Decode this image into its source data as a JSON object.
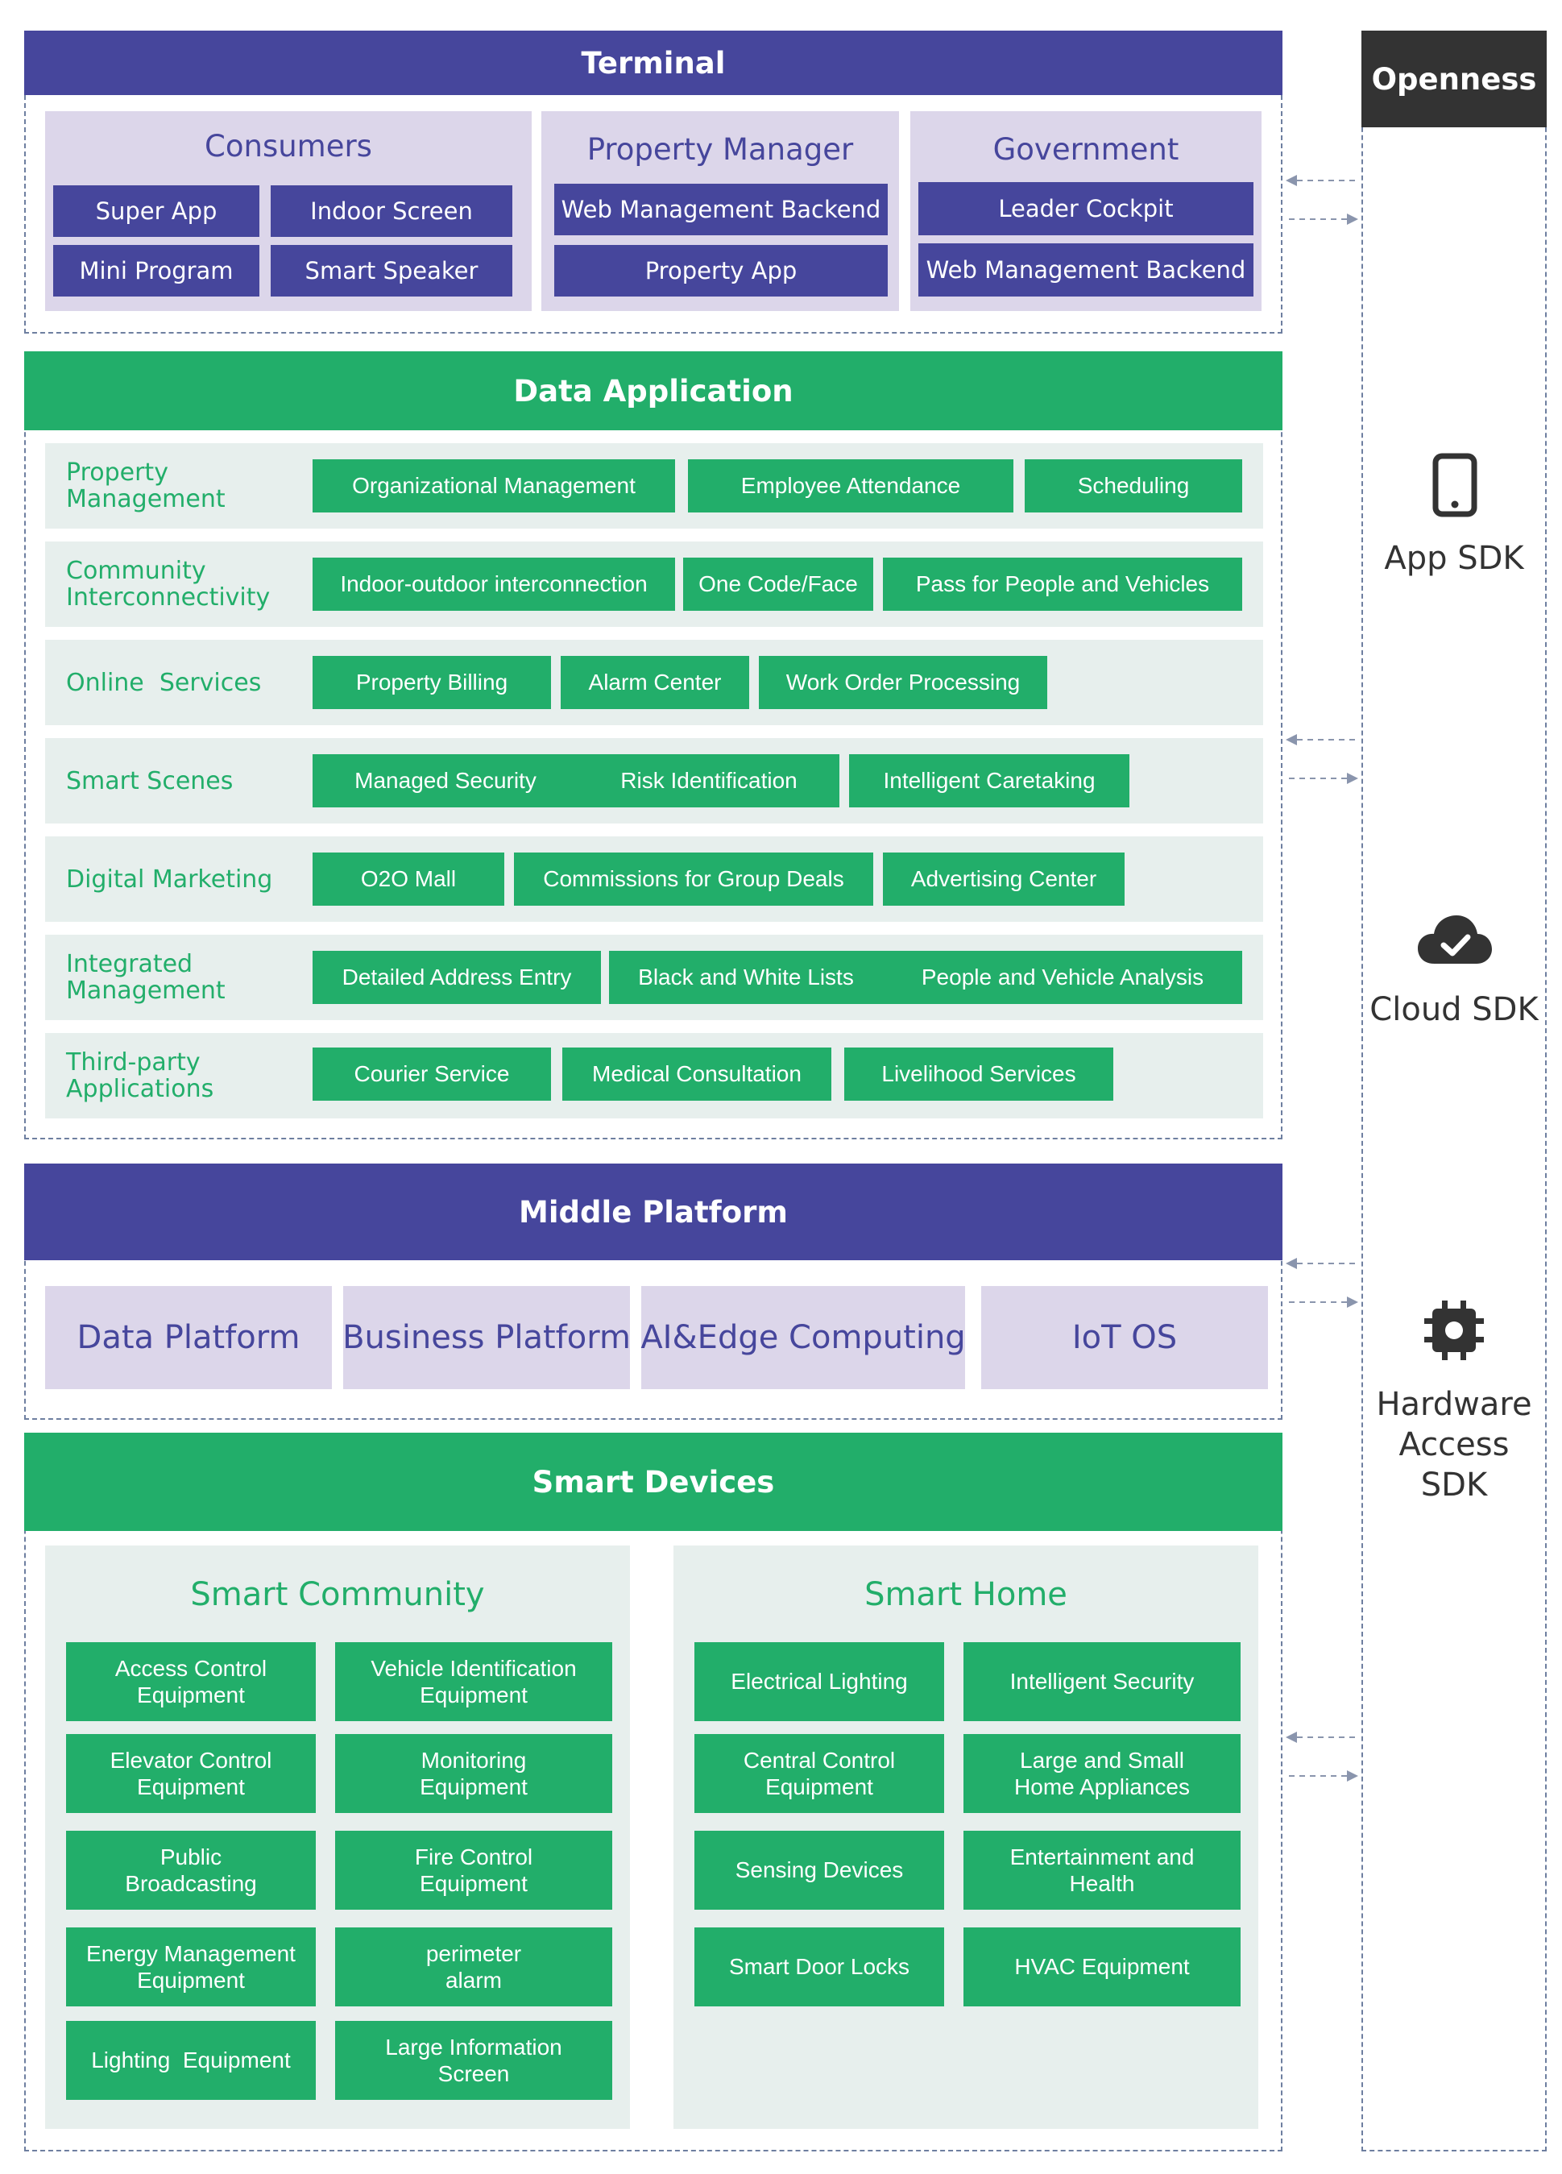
{
  "terminal": {
    "title": "Terminal",
    "groups": [
      {
        "title": "Consumers",
        "items": [
          "Super App",
          "Indoor Screen",
          "Mini Program",
          "Smart Speaker"
        ]
      },
      {
        "title": "Property Manager",
        "items": [
          "Web Management Backend",
          "Property App"
        ]
      },
      {
        "title": "Government",
        "items": [
          "Leader Cockpit",
          "Web Management Backend"
        ]
      }
    ]
  },
  "data_application": {
    "title": "Data Application",
    "rows": [
      {
        "label": "Property\nManagement",
        "items": [
          "Organizational Management",
          "Employee Attendance",
          "Scheduling"
        ]
      },
      {
        "label": "Community\nInterconnectivity",
        "items": [
          "Indoor-outdoor interconnection",
          "One Code/Face",
          "Pass for People and Vehicles"
        ]
      },
      {
        "label": "Online  Services",
        "items": [
          "Property Billing",
          "Alarm Center",
          "Work Order Processing"
        ]
      },
      {
        "label": "Smart Scenes",
        "items": [
          "Managed Security",
          "Risk Identification",
          "Intelligent Caretaking"
        ]
      },
      {
        "label": "Digital Marketing",
        "items": [
          "O2O Mall",
          "Commissions for Group Deals",
          "Advertising Center"
        ]
      },
      {
        "label": "Integrated\nManagement",
        "items": [
          "Detailed Address Entry",
          "Black and White Lists",
          "People and Vehicle Analysis"
        ]
      },
      {
        "label": "Third-party\nApplications",
        "items": [
          "Courier Service",
          "Medical Consultation",
          "Livelihood Services"
        ]
      }
    ]
  },
  "middle_platform": {
    "title": "Middle Platform",
    "items": [
      "Data Platform",
      "Business Platform",
      "AI&Edge Computing",
      "IoT OS"
    ]
  },
  "smart_devices": {
    "title": "Smart Devices",
    "community": {
      "title": "Smart Community",
      "items": [
        "Access Control\nEquipment",
        "Vehicle Identification\nEquipment",
        "Elevator Control\nEquipment",
        "Monitoring\nEquipment",
        "Public\nBroadcasting",
        "Fire Control\nEquipment",
        "Energy Management\nEquipment",
        "perimeter\nalarm",
        "Lighting  Equipment",
        "Large Information\nScreen"
      ]
    },
    "home": {
      "title": "Smart Home",
      "items": [
        "Electrical Lighting",
        "Intelligent Security",
        "Central Control\nEquipment",
        "Large and Small\nHome Appliances",
        "Sensing Devices",
        "Entertainment and\nHealth",
        "Smart Door Locks",
        "HVAC Equipment"
      ]
    }
  },
  "openness": {
    "title": "Openness",
    "sdks": [
      {
        "label": "App SDK",
        "icon": "phone-icon"
      },
      {
        "label": "Cloud SDK",
        "icon": "cloud-check-icon"
      },
      {
        "label": "Hardware\nAccess SDK",
        "icon": "chip-icon"
      }
    ]
  },
  "colors": {
    "purple": "#46469c",
    "green": "#22ae6a",
    "lavender": "#dcd6ea",
    "mint": "#e7efed",
    "dark": "#333333"
  }
}
